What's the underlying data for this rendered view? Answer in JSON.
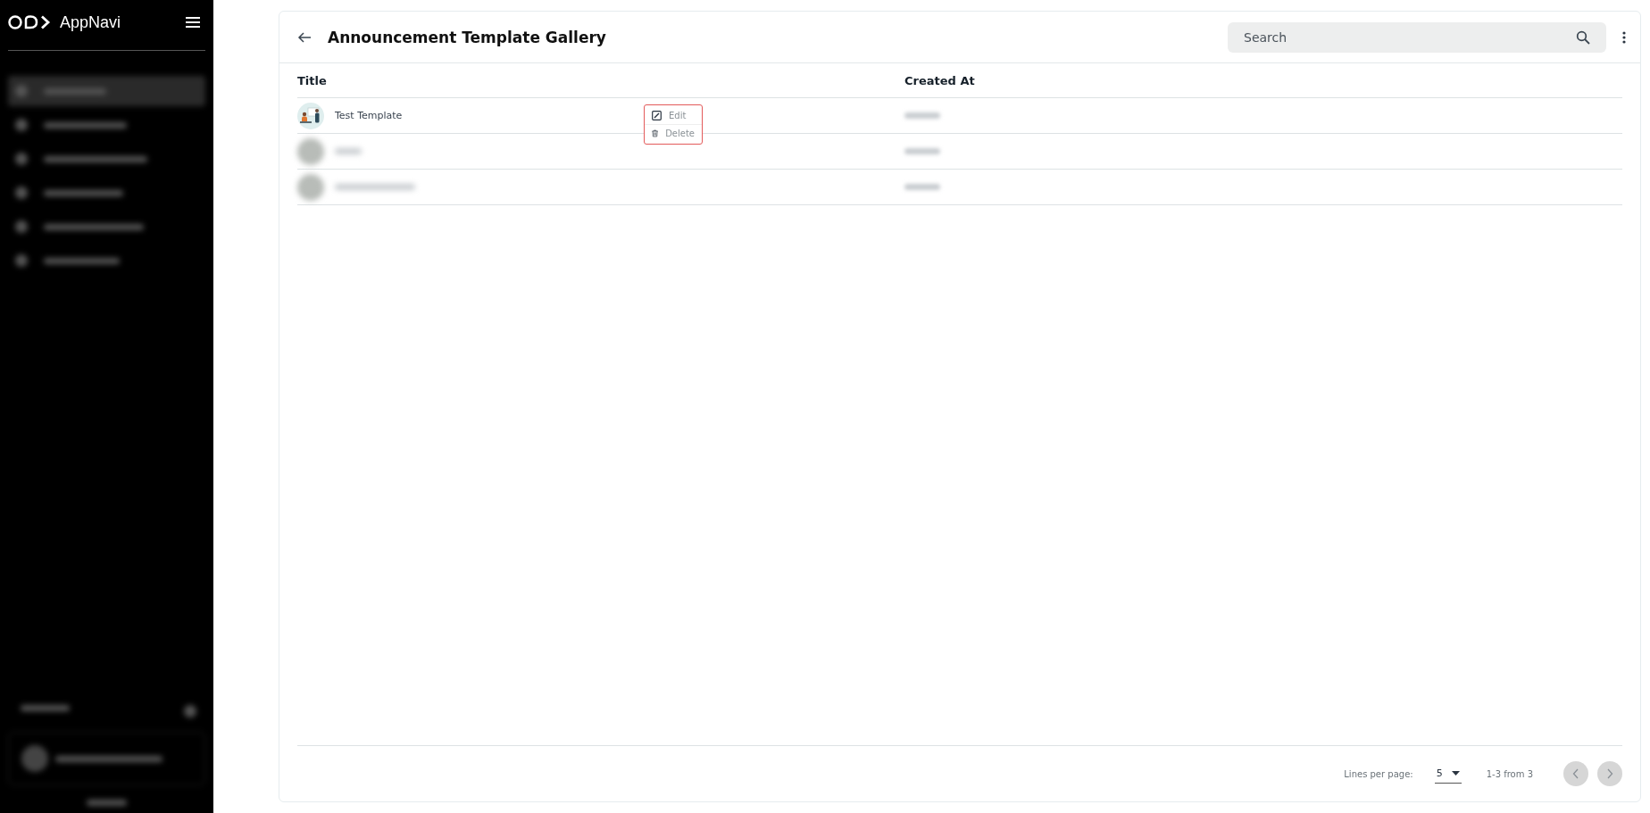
{
  "sidebar": {
    "brand": "AppNavi",
    "blurred_items": [
      {
        "selected": true
      },
      {
        "selected": false
      },
      {
        "selected": false
      },
      {
        "selected": false
      },
      {
        "selected": false
      },
      {
        "selected": false
      }
    ]
  },
  "header": {
    "title": "Announcement Template Gallery",
    "search": {
      "placeholder": "Search"
    }
  },
  "table": {
    "columns": [
      "Title",
      "Created At"
    ],
    "rows": [
      {
        "title": "Test Template",
        "blurred": false
      },
      {
        "blurred": true
      },
      {
        "blurred": true
      }
    ]
  },
  "context_menu": {
    "items": [
      {
        "kind": "edit",
        "label": "Edit"
      },
      {
        "kind": "delete",
        "label": "Delete"
      }
    ]
  },
  "pagination": {
    "lines_label": "Lines per page:",
    "lines_value": "5",
    "range": "1-3 from 3",
    "prev_disabled": true,
    "next_disabled": true
  }
}
